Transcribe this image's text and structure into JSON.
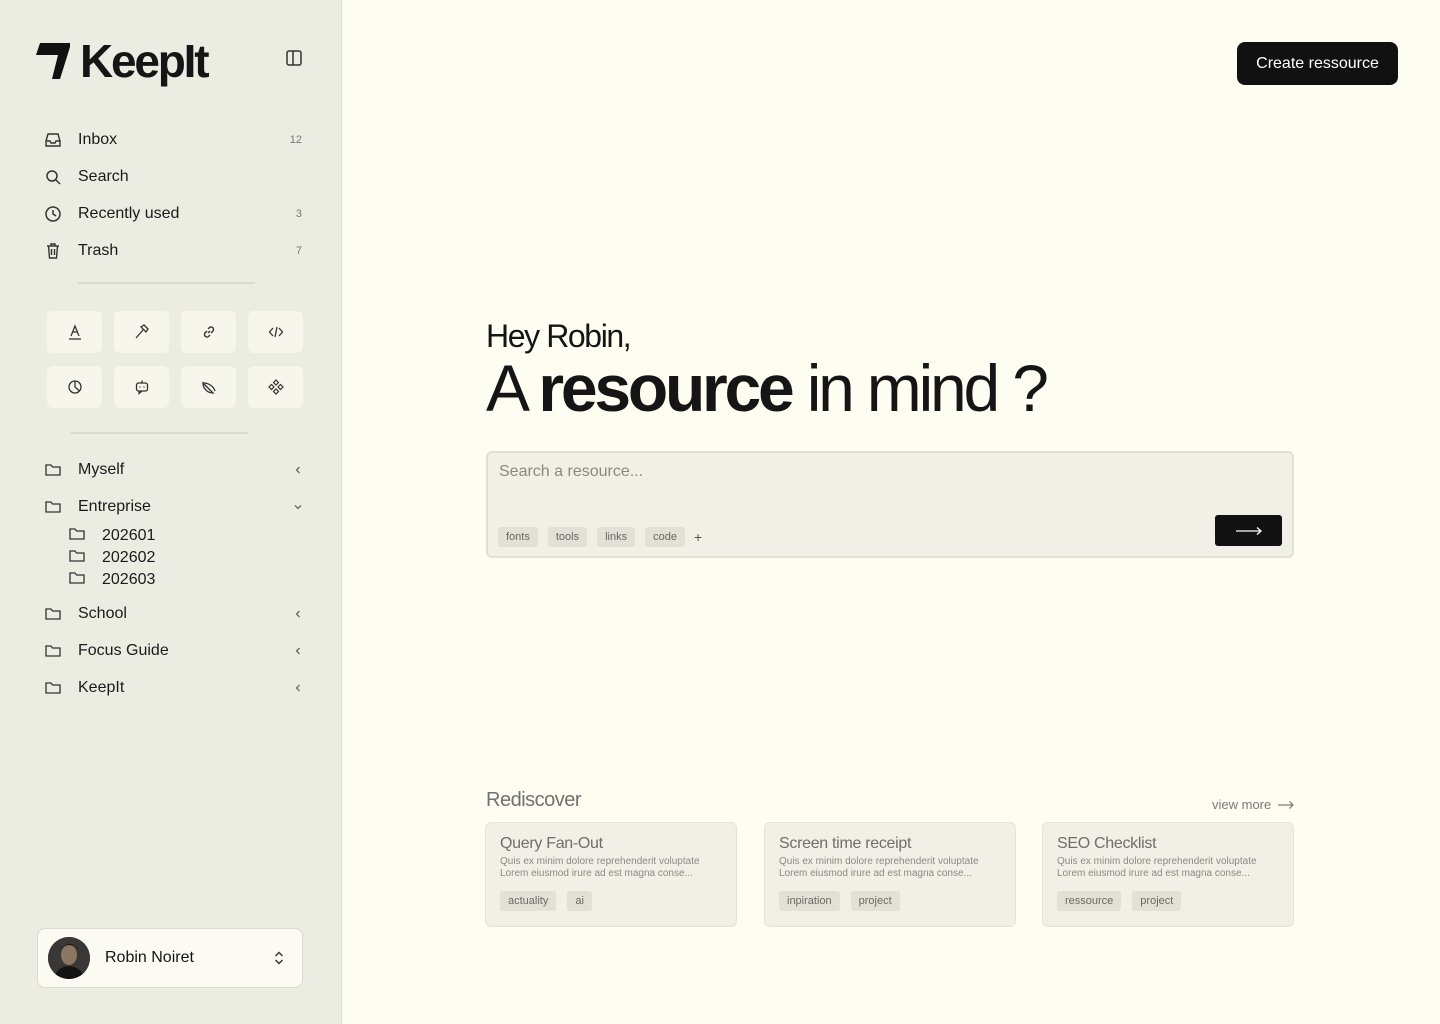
{
  "app": {
    "name": "KeepIt"
  },
  "nav": {
    "items": [
      {
        "label": "Inbox",
        "count": "12",
        "icon": "inbox-icon"
      },
      {
        "label": "Search",
        "count": "",
        "icon": "search-icon"
      },
      {
        "label": "Recently used",
        "count": "3",
        "icon": "clock-icon"
      },
      {
        "label": "Trash",
        "count": "7",
        "icon": "trash-icon"
      }
    ]
  },
  "tools": [
    "font-icon",
    "hammer-icon",
    "link-icon",
    "code-icon",
    "pie-chart-icon",
    "bot-icon",
    "melon-icon",
    "component-icon"
  ],
  "folders": {
    "myself": "Myself",
    "entreprise": "Entreprise",
    "sub": [
      "202601",
      "202602",
      "202603"
    ],
    "school": "School",
    "focus": "Focus Guide",
    "keepit": "KeepIt"
  },
  "user": {
    "name": "Robin Noiret"
  },
  "header": {
    "create_label": "Create ressource"
  },
  "hero": {
    "greeting": "Hey Robin,",
    "headline_prefix": "A ",
    "headline_bold": "resource",
    "headline_suffix": " in mind ?"
  },
  "search": {
    "placeholder": "Search a resource...",
    "tags": [
      "fonts",
      "tools",
      "links",
      "code"
    ],
    "add_label": "+"
  },
  "rediscover": {
    "title": "Rediscover",
    "view_more": "view more",
    "cards": [
      {
        "title": "Query Fan-Out",
        "desc1": "Quis ex minim dolore reprehenderit voluptate",
        "desc2": "Lorem eiusmod irure ad est magna conse...",
        "tags": [
          "actuality",
          "ai"
        ]
      },
      {
        "title": "Screen time receipt",
        "desc1": "Quis ex minim dolore reprehenderit voluptate",
        "desc2": "Lorem eiusmod irure ad est magna conse...",
        "tags": [
          "inpiration",
          "project"
        ]
      },
      {
        "title": "SEO Checklist",
        "desc1": "Quis ex minim dolore reprehenderit voluptate",
        "desc2": "Lorem eiusmod irure ad est magna conse...",
        "tags": [
          "ressource",
          "project"
        ]
      }
    ]
  },
  "colors": {
    "sidebar": "#ecede2",
    "page": "#fefdf2",
    "primary": "#111111"
  }
}
